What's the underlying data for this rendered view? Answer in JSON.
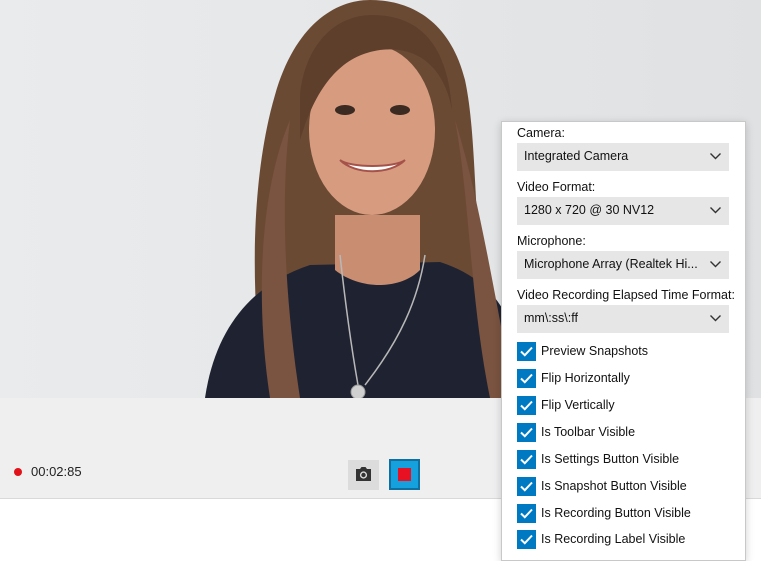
{
  "preview": {
    "image": "webcam-preview-woman-smiling"
  },
  "toolbar": {
    "recording_time": "00:02:85",
    "snapshot_icon": "camera-icon",
    "stop_icon": "stop-icon",
    "accent": "#14a1de",
    "record_color": "#e2121b"
  },
  "settings": {
    "camera_label": "Camera:",
    "camera_value": "Integrated Camera",
    "video_format_label": "Video Format:",
    "video_format_value": "1280 x 720 @ 30 NV12",
    "microphone_label": "Microphone:",
    "microphone_value": "Microphone Array (Realtek Hi...",
    "elapsed_format_label": "Video Recording Elapsed Time Format:",
    "elapsed_format_value": "mm\\:ss\\:ff",
    "checkbox_color": "#0079c3",
    "options": [
      {
        "label": "Preview Snapshots",
        "checked": true
      },
      {
        "label": "Flip Horizontally",
        "checked": true
      },
      {
        "label": "Flip Vertically",
        "checked": true
      },
      {
        "label": "Is Toolbar Visible",
        "checked": true
      },
      {
        "label": "Is Settings Button Visible",
        "checked": true
      },
      {
        "label": "Is Snapshot Button Visible",
        "checked": true
      },
      {
        "label": "Is Recording Button Visible",
        "checked": true
      },
      {
        "label": "Is Recording Label Visible",
        "checked": true
      }
    ]
  }
}
